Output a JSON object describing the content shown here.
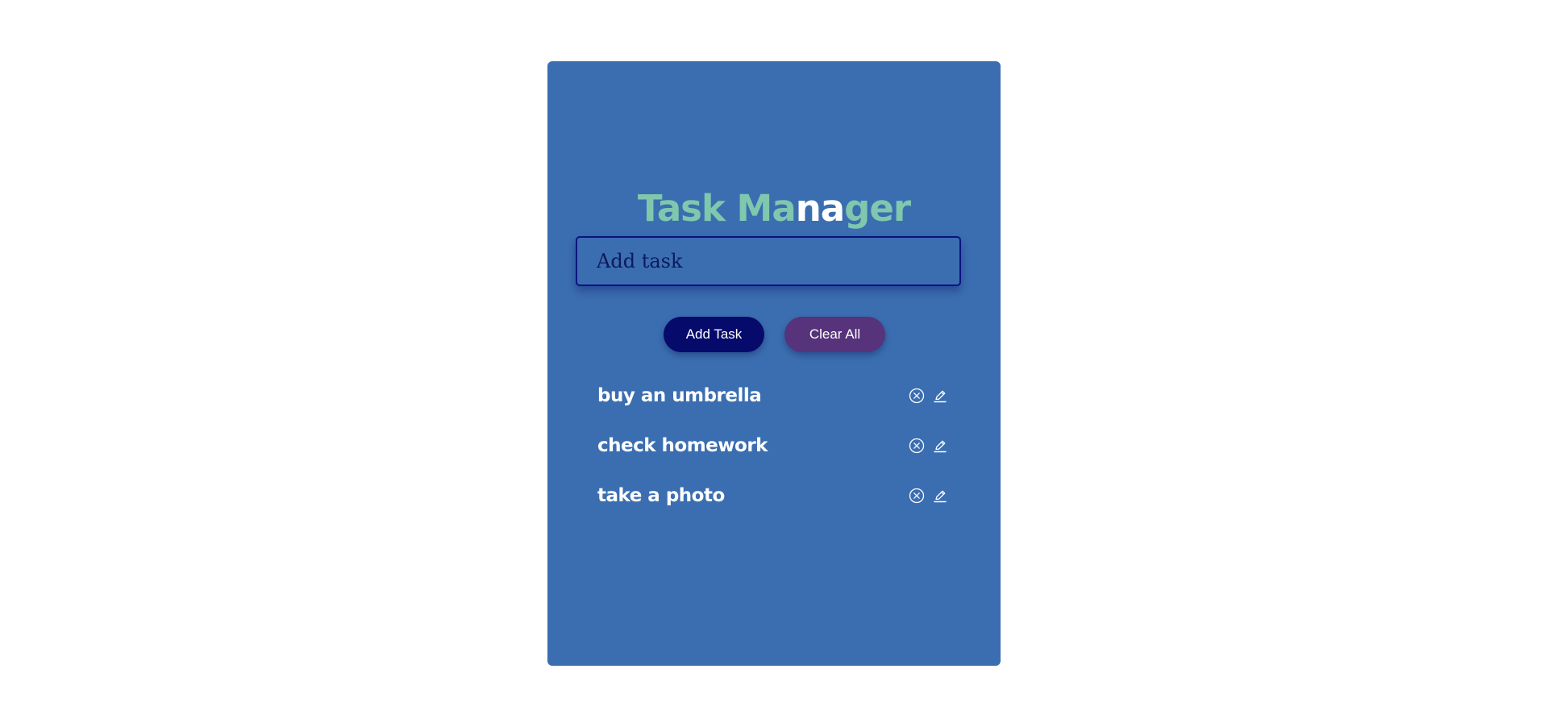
{
  "app": {
    "title_parts": [
      "Task Ma",
      "na",
      "ger"
    ]
  },
  "input": {
    "placeholder": "Add task",
    "value": ""
  },
  "buttons": {
    "add_label": "Add Task",
    "clear_label": "Clear All"
  },
  "tasks": [
    {
      "text": "buy an umbrella",
      "delete_icon": "circle-x-icon",
      "edit_icon": "pencil-icon"
    },
    {
      "text": "check homework",
      "delete_icon": "circle-x-icon",
      "edit_icon": "pencil-icon"
    },
    {
      "text": "take a photo",
      "delete_icon": "circle-x-icon",
      "edit_icon": "pencil-icon"
    }
  ],
  "colors": {
    "card_background": "#3b6eb0",
    "title_accent": "#7fc7ad",
    "title_highlight": "#ffffff",
    "add_button": "#060a6b",
    "clear_button": "#56337a",
    "input_border": "#0a1380"
  }
}
